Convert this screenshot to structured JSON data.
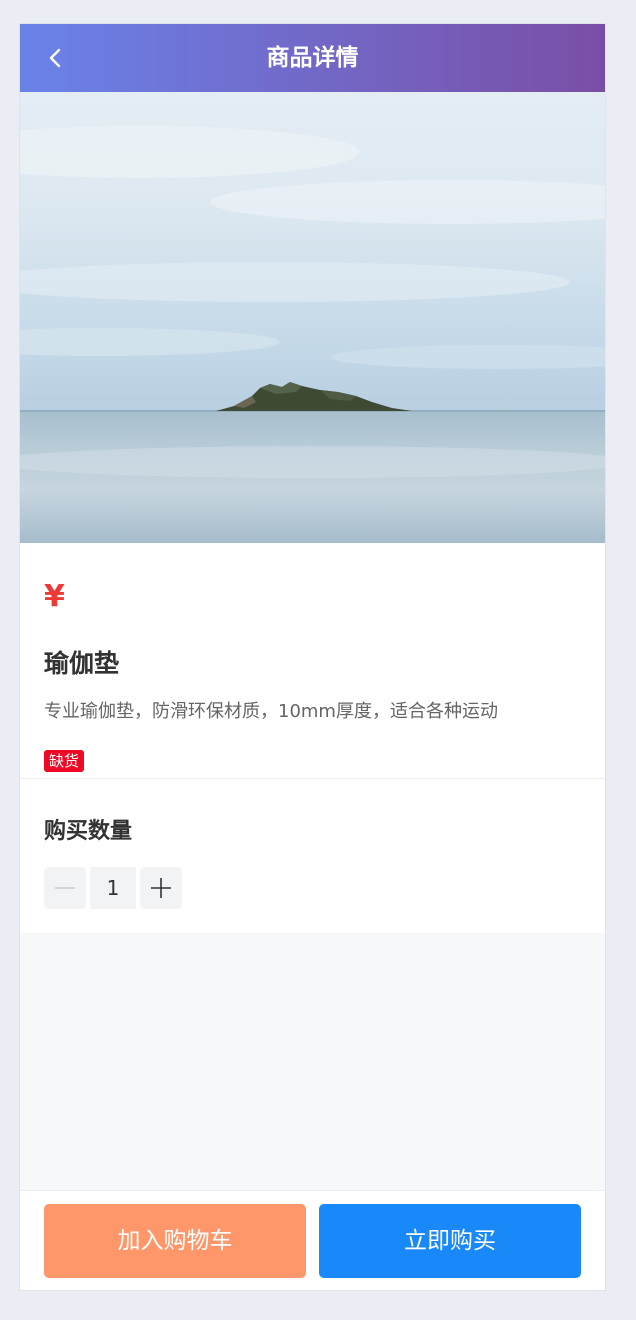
{
  "navbar": {
    "title": "商品详情",
    "back_icon": "chevron-left-icon"
  },
  "product": {
    "price_symbol": "¥",
    "name": "瑜伽垫",
    "description": "专业瑜伽垫，防滑环保材质，10mm厚度，适合各种运动",
    "stock_badge": "缺货",
    "image": "island-seascape-photo"
  },
  "quantity": {
    "label": "购买数量",
    "value": "1",
    "decrease_icon": "minus-icon",
    "increase_icon": "plus-icon"
  },
  "actions": {
    "add_to_cart": "加入购物车",
    "buy_now": "立即购买"
  },
  "colors": {
    "nav_gradient_start": "#6a83e9",
    "nav_gradient_end": "#7a4ea6",
    "price": "#ee3a35",
    "badge": "#ee0a24",
    "cart_button": "#ff976a",
    "buy_button": "#1989fa"
  }
}
